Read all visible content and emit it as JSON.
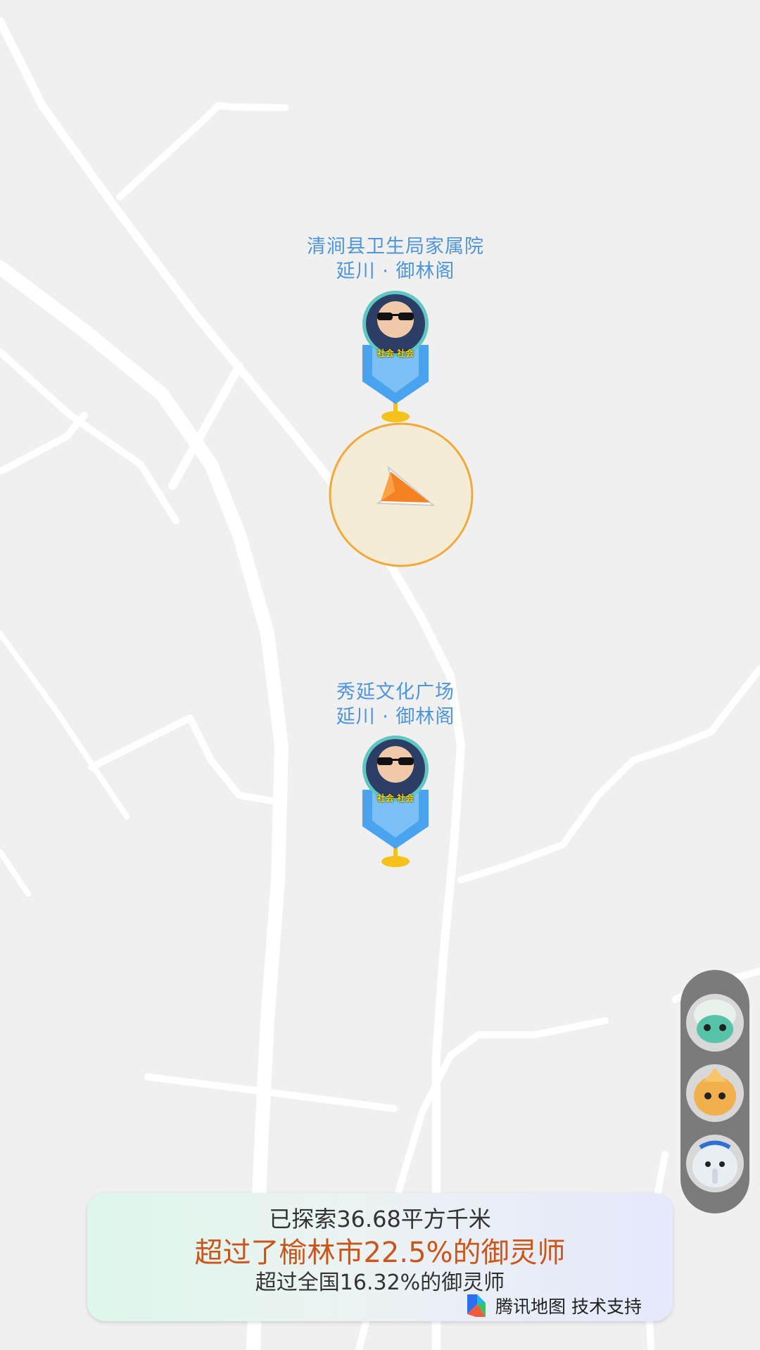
{
  "map": {
    "colors": {
      "background": "#f0f0f0",
      "road": "#ffffff",
      "marker_blue": "#4aa3ee",
      "accent_orange": "#f08a1c"
    },
    "pois": [
      {
        "name": "清涧县卫生局家属院",
        "subtitle": "延川 · 御林阁",
        "avatar_tag": "社会 社会"
      },
      {
        "name": "秀延文化广场",
        "subtitle": "延川 · 御林阁",
        "avatar_tag": "社会 社会"
      }
    ],
    "current_location_icon": "navigation-arrow-icon"
  },
  "pets": [
    {
      "name": "green-spirit-pet",
      "icon": "pet-avatar-icon"
    },
    {
      "name": "orange-spirit-pet",
      "icon": "pet-avatar-icon"
    },
    {
      "name": "elephant-spirit-pet",
      "icon": "pet-avatar-icon"
    }
  ],
  "stats": {
    "explored": "已探索36.68平方千米",
    "city_rank": "超过了榆林市22.5%的御灵师",
    "national_rank": "超过全国16.32%的御灵师",
    "credit": "腾讯地图 技术支持"
  }
}
